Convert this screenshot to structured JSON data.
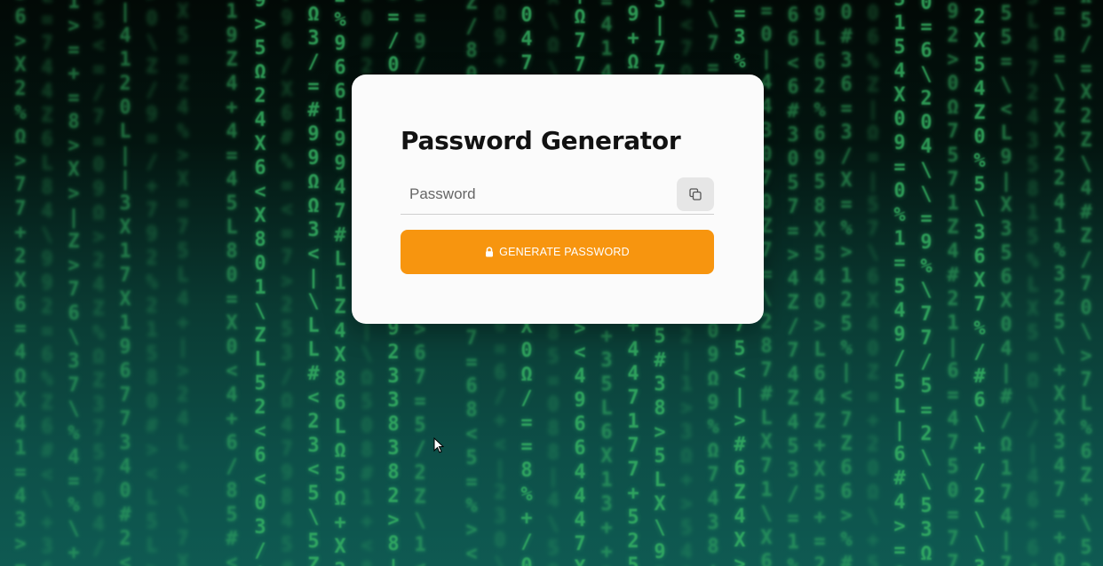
{
  "app": {
    "title": "Password Generator"
  },
  "password_field": {
    "value": "",
    "placeholder": "Password"
  },
  "copy_button": {
    "icon": "copy-icon"
  },
  "generate_button": {
    "label": "GENERATE PASSWORD",
    "icon": "lock-icon"
  },
  "colors": {
    "accent": "#f7950f",
    "card_background": "#fbfbfb",
    "matrix_green": "#37b865",
    "background_top": "#020906",
    "background_bottom": "#0f5a52"
  }
}
